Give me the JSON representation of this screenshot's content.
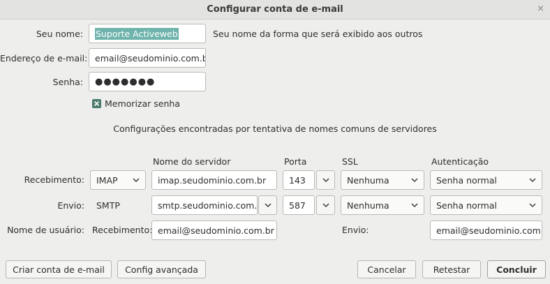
{
  "window": {
    "title": "Configurar conta de e-mail",
    "close_glyph": "×"
  },
  "identity": {
    "name_label": "Seu nome:",
    "name_value": "Suporte Activeweb",
    "name_hint": "Seu nome da forma que será exibido aos outros",
    "email_label": "Endereço de e-mail:",
    "email_value": "email@seudominio.com.br",
    "password_label": "Senha:",
    "password_value": "●●●●●●●",
    "remember_label": "Memorizar senha",
    "remember_checked": true
  },
  "status_message": "Configurações encontradas por tentativa de nomes comuns de servidores",
  "server": {
    "headers": {
      "server_name": "Nome do servidor",
      "port": "Porta",
      "ssl": "SSL",
      "auth": "Autenticação"
    },
    "incoming": {
      "label": "Recebimento:",
      "protocol": "IMAP",
      "host": "imap.seudominio.com.br",
      "port": "143",
      "ssl": "Nenhuma",
      "auth": "Senha normal"
    },
    "outgoing": {
      "label": "Envio:",
      "protocol": "SMTP",
      "host": "smtp.seudominio.com.br",
      "port": "587",
      "ssl": "Nenhuma",
      "auth": "Senha normal"
    },
    "username": {
      "label": "Nome de usuário:",
      "incoming_label": "Recebimento:",
      "incoming_value": "email@seudominio.com.br",
      "outgoing_label": "Envio:",
      "outgoing_value": "email@seudominio.com.b"
    }
  },
  "buttons": {
    "create": "Criar conta de e-mail",
    "advanced": "Config avançada",
    "cancel": "Cancelar",
    "retest": "Retestar",
    "done": "Concluir"
  },
  "colors": {
    "selection": "#6eb3ac",
    "checkbox": "#4a7a6c",
    "window_bg": "#eeeeec"
  },
  "icons": [
    "close-icon",
    "chevron-down-icon",
    "checkmark-icon"
  ]
}
